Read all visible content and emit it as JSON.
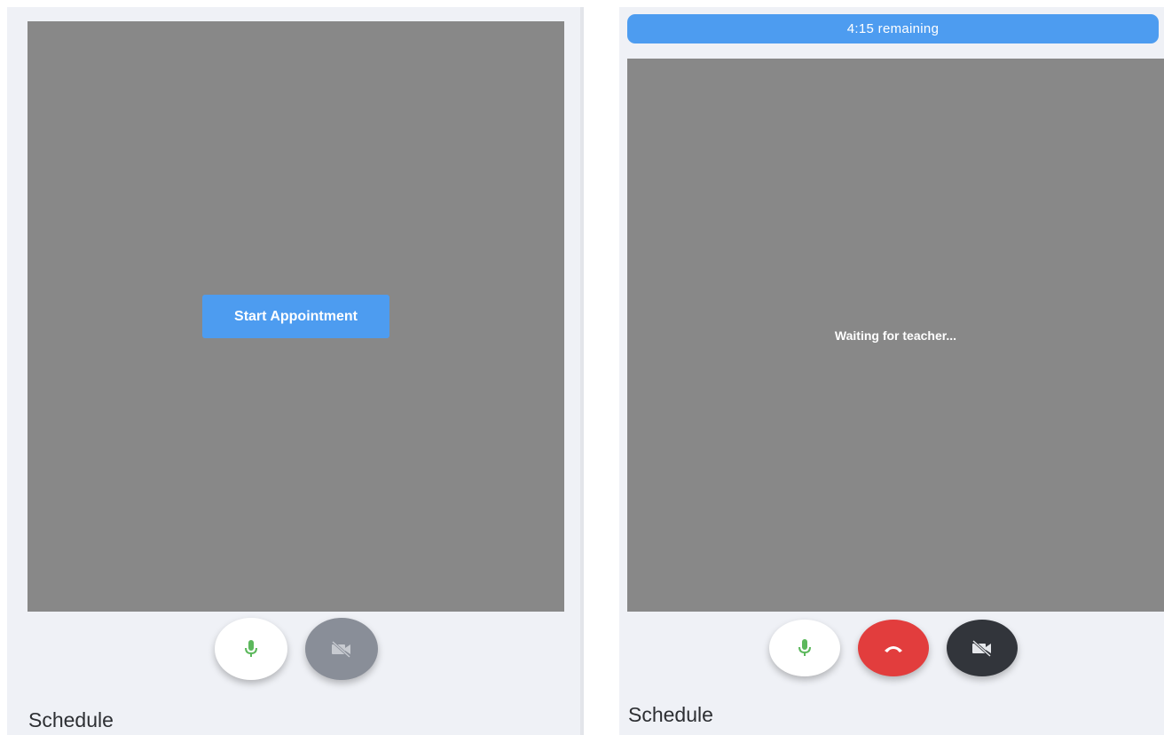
{
  "left_panel": {
    "start_button_label": "Start Appointment",
    "schedule_title": "Schedule",
    "controls": {
      "mic_icon": "mic-icon",
      "camera_icon": "video-off-icon"
    }
  },
  "right_panel": {
    "timer_text": "4:15 remaining",
    "waiting_text": "Waiting for teacher...",
    "schedule_title": "Schedule",
    "controls": {
      "mic_icon": "mic-icon",
      "hangup_icon": "phone-hangup-icon",
      "camera_icon": "video-off-icon"
    }
  },
  "colors": {
    "accent_blue": "#4d9cf0",
    "video_bg": "#888888",
    "panel_bg": "#eff1f6",
    "mic_green": "#5cb85c",
    "hangup_red": "#e23d3d",
    "camera_dark": "#32353b",
    "camera_disabled": "#898e98"
  }
}
